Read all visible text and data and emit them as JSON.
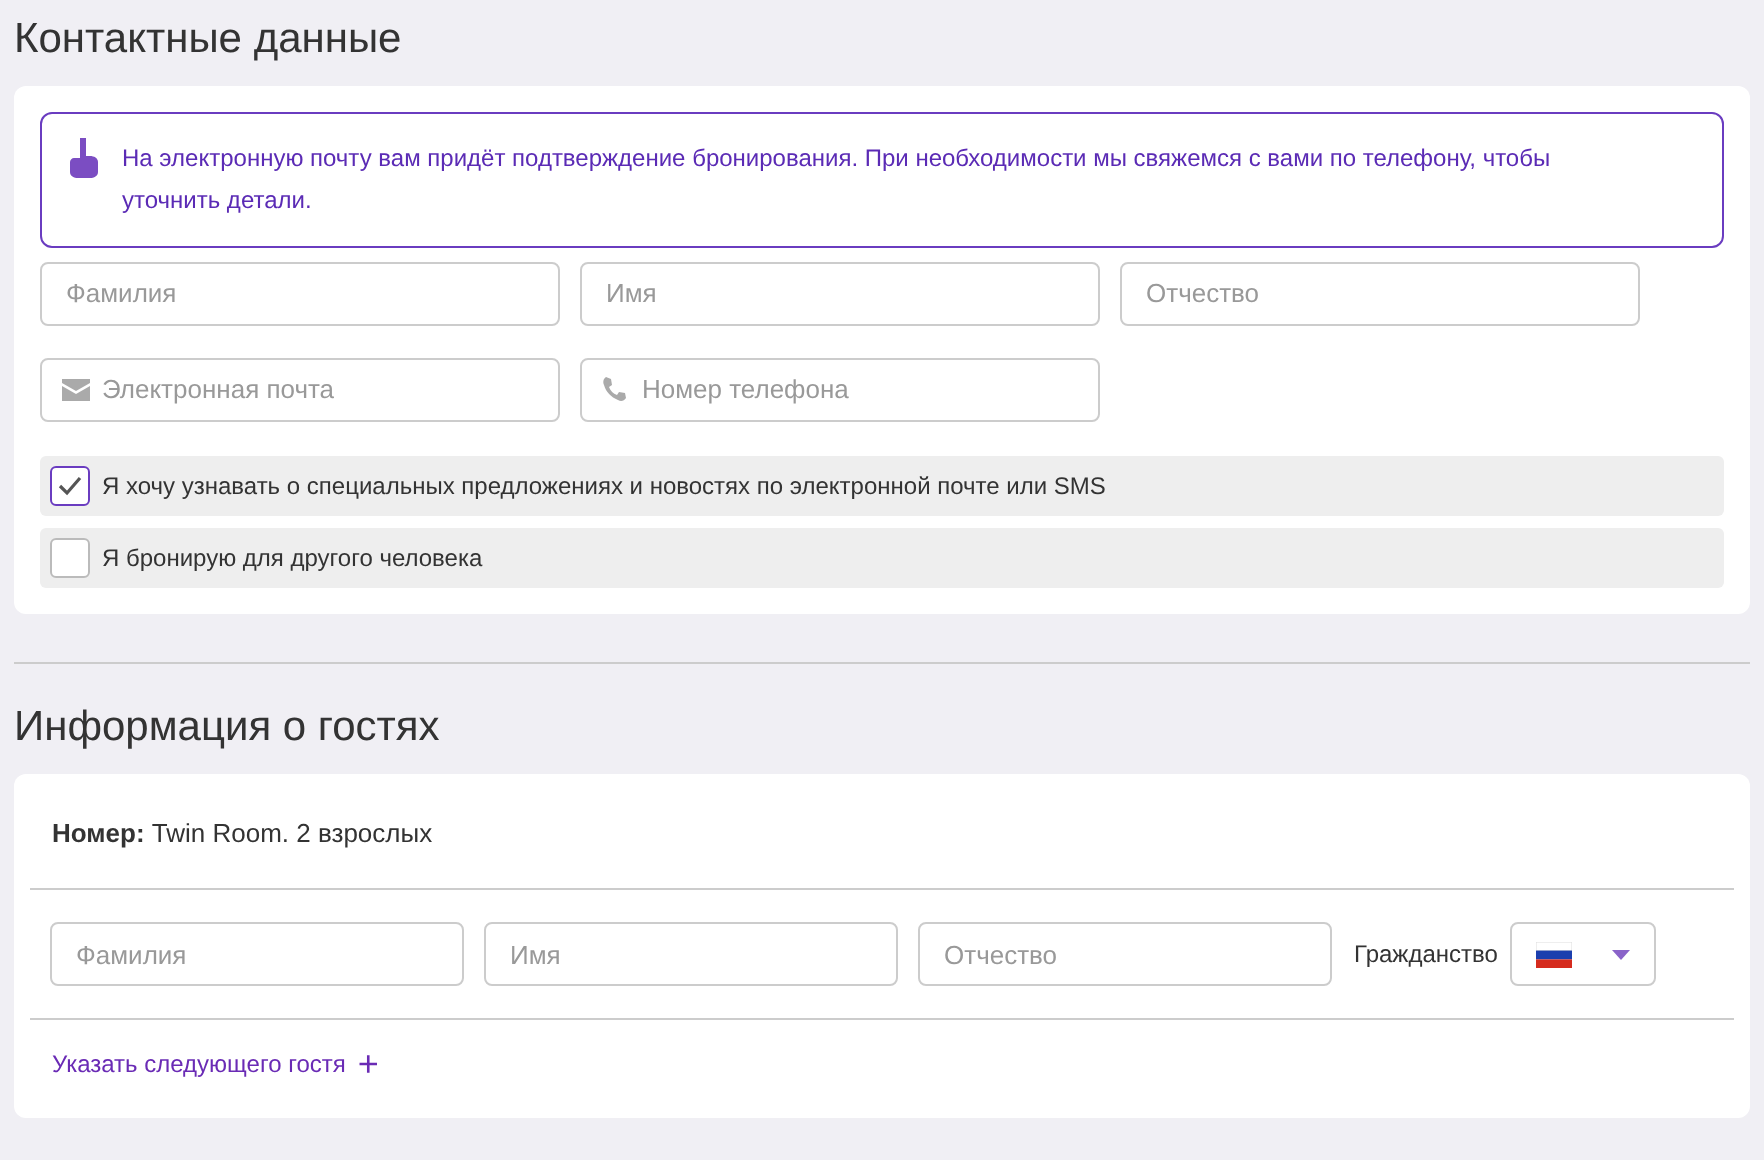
{
  "contact": {
    "title": "Контактные данные",
    "notice": "На электронную почту вам придёт подтверждение бронирования. При необходимости мы свяжемся с вами по телефону, чтобы уточнить детали.",
    "fields": [
      {
        "placeholder": "Фамилия",
        "kind": "plain"
      },
      {
        "placeholder": "Имя",
        "kind": "plain"
      },
      {
        "placeholder": "Отчество",
        "kind": "plain"
      },
      {
        "placeholder": "Электронная почта",
        "kind": "email"
      },
      {
        "placeholder": "Номер телефона",
        "kind": "phone"
      }
    ],
    "checkboxes": [
      {
        "label": "Я хочу узнавать о специальных предложениях и новостях по электронной почте или SMS",
        "checked": true
      },
      {
        "label": "Я бронирую для другого человека",
        "checked": false
      }
    ]
  },
  "guests": {
    "title": "Информация о гостях",
    "room": "**Номер:** Twin Room. 2 взрослых",
    "fields": [
      {
        "placeholder": "Фамилия"
      },
      {
        "placeholder": "Имя"
      },
      {
        "placeholder": "Отчество"
      }
    ],
    "citizenship_label": "Гражданство",
    "add_guest": "Указать следующего гостя",
    "add_icon": "+"
  }
}
